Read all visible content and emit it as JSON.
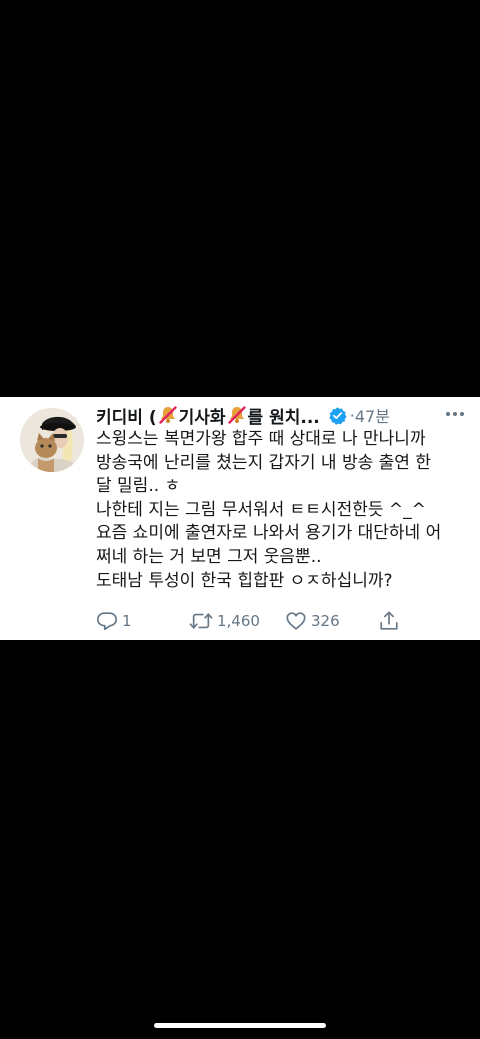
{
  "tweet": {
    "author": {
      "name_part1": "키디비 (",
      "name_part2": "기사화",
      "name_part3": "를 원치...",
      "name_icon": "muted-bell-icon",
      "verified_icon": "verified-badge-icon",
      "avatar_icon": "profile-photo-avatar"
    },
    "separator": "·",
    "time": "47분",
    "more_icon": "more-dots-icon",
    "lines": [
      "스윙스는 복면가왕 합주 때 상대로 나 만나니까",
      "방송국에 난리를 쳤는지 갑자기 내 방송 출연 한",
      "달 밀림.. ㅎ",
      "나한테 지는 그림 무서워서 ㅌㅌ시전한듯 ^_^",
      "요즘 쇼미에 출연자로 나와서 용기가 대단하네 어",
      "쩌네 하는 거 보면 그저 웃음뿐..",
      "도태남 투성이 한국 힙합판 ㅇㅈ하십니까?"
    ],
    "actions": {
      "reply_icon": "reply-icon",
      "reply_count": "1",
      "retweet_icon": "retweet-icon",
      "retweet_count": "1,460",
      "like_icon": "heart-icon",
      "like_count": "326",
      "share_icon": "share-icon"
    }
  },
  "colors": {
    "background": "#000000",
    "card": "#ffffff",
    "text": "#14171a",
    "muted": "#657786",
    "verified": "#1da1f2",
    "bell": "#e9a23b",
    "strike": "#e0245e"
  }
}
